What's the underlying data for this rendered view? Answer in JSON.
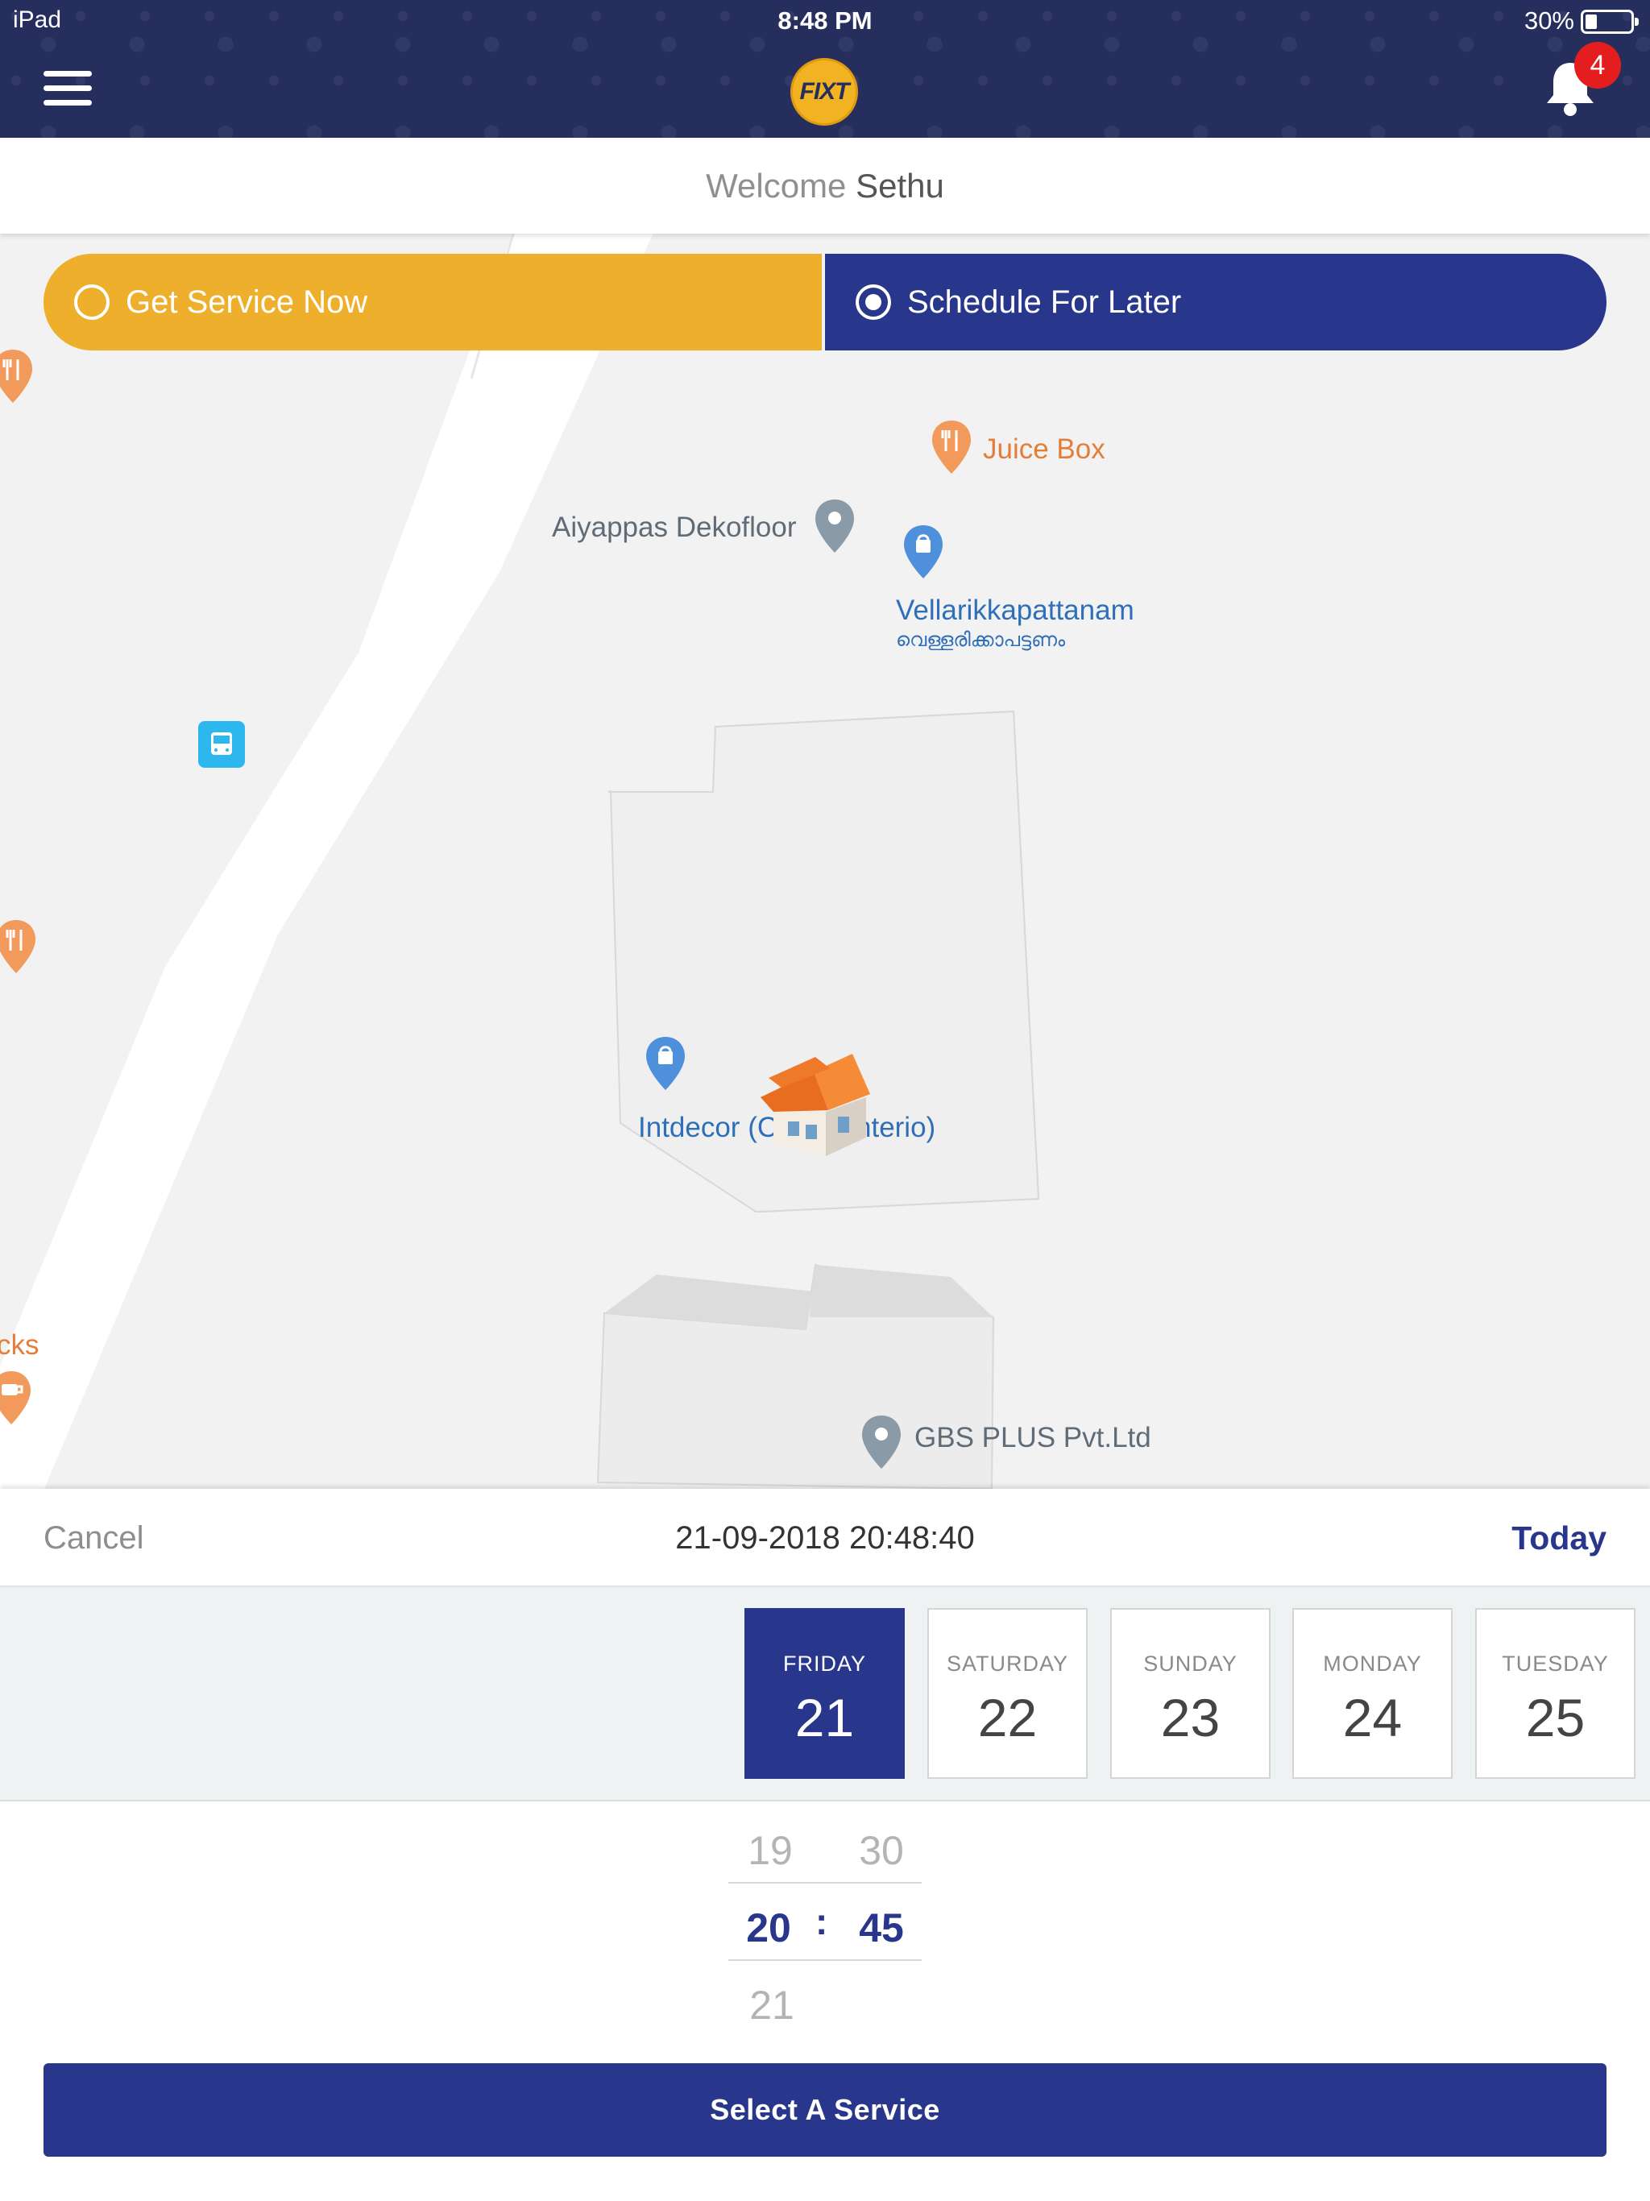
{
  "status_bar": {
    "device": "iPad",
    "time": "8:48 PM",
    "battery": "30%"
  },
  "header": {
    "logo_text": "FIXT",
    "notification_count": "4",
    "menu_icon": "hamburger-icon",
    "bell_icon": "bell-icon"
  },
  "welcome": {
    "prefix": "Welcome",
    "name": "Sethu"
  },
  "mode_toggle": {
    "now_label": "Get Service Now",
    "later_label": "Schedule For Later",
    "selected": "later"
  },
  "map": {
    "pois": [
      {
        "label": "Juice Box",
        "type": "restaurant"
      },
      {
        "label": "Aiyappas Dekofloor",
        "type": "place"
      },
      {
        "label": "Vellarikkapattanam",
        "sublabel": "വെള്ളരിക്കാപട്ടണം",
        "type": "shop"
      },
      {
        "label": "Intdecor (C",
        "label_tail": "nterio)",
        "type": "shop"
      },
      {
        "label": "GBS PLUS Pvt.Ltd",
        "type": "place"
      },
      {
        "label": "cks",
        "type": "cafe"
      }
    ],
    "marker": "house-marker"
  },
  "picker": {
    "cancel_label": "Cancel",
    "selected_datetime": "21-09-2018 20:48:40",
    "today_label": "Today",
    "days": [
      {
        "name": "FRIDAY",
        "num": "21",
        "selected": true
      },
      {
        "name": "SATURDAY",
        "num": "22",
        "selected": false
      },
      {
        "name": "SUNDAY",
        "num": "23",
        "selected": false
      },
      {
        "name": "MONDAY",
        "num": "24",
        "selected": false
      },
      {
        "name": "TUESDAY",
        "num": "25",
        "selected": false
      }
    ],
    "hours": {
      "prev": "19",
      "current": "20",
      "next": "21"
    },
    "minutes": {
      "prev": "30",
      "current": "45"
    },
    "separator": ":"
  },
  "action": {
    "select_service_label": "Select A Service"
  },
  "colors": {
    "navy": "#28368c",
    "header_bg": "#262e5e",
    "yellow": "#eeb02c",
    "badge_red": "#e41e1e"
  }
}
